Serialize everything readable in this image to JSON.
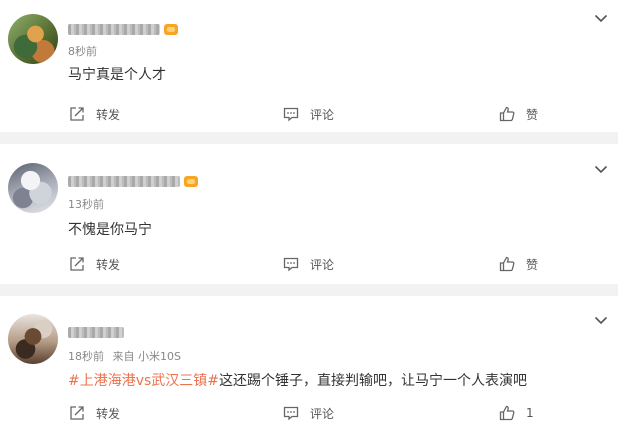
{
  "comments": [
    {
      "time": "8秒前",
      "source": "",
      "text_tag": "",
      "text": "马宁真是个人才",
      "actions": {
        "repost": "转发",
        "comment": "评论",
        "like": "赞"
      }
    },
    {
      "time": "13秒前",
      "source": "",
      "text_tag": "",
      "text": "不愧是你马宁",
      "actions": {
        "repost": "转发",
        "comment": "评论",
        "like": "赞"
      }
    },
    {
      "time": "18秒前",
      "source": "来自 小米10S",
      "text_tag": "#上港海港vs武汉三镇#",
      "text": "这还踢个锤子，直接判输吧，让马宁一个人表演吧",
      "actions": {
        "repost": "转发",
        "comment": "评论",
        "like": "1"
      }
    }
  ],
  "colors": {
    "tag": "#eb7350",
    "separator": "#f2f2f2",
    "text": "#333333",
    "meta": "#888888",
    "vip_badge": "#f5a623"
  },
  "icons": [
    "chevron-down-icon",
    "repost-icon",
    "comment-icon",
    "like-icon",
    "vip-badge-icon"
  ]
}
